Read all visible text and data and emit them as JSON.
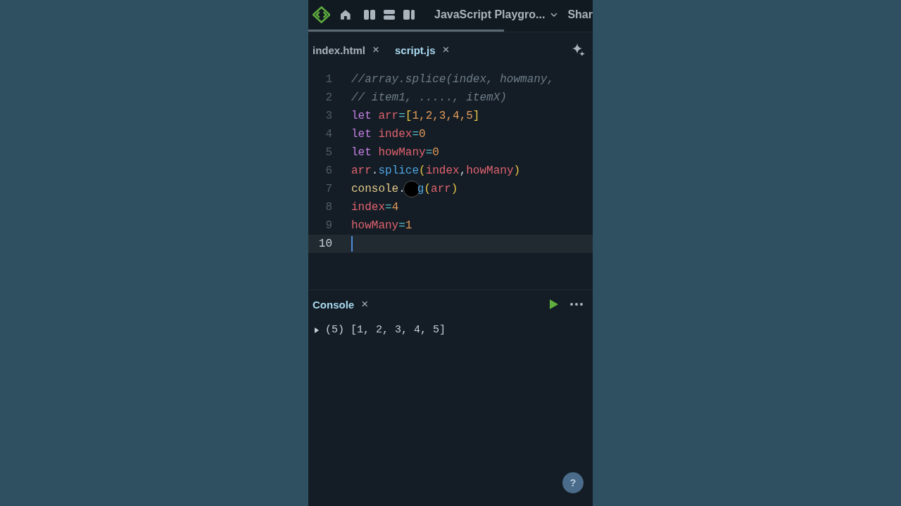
{
  "toolbar": {
    "title": "JavaScript Playgro...",
    "share": "Shar"
  },
  "tabs": [
    {
      "label": "index.html",
      "close": "×",
      "selected": false
    },
    {
      "label": "script.js",
      "close": "×",
      "selected": true
    }
  ],
  "editor": {
    "lines": [
      {
        "number": "1",
        "current": false,
        "tokens": [
          {
            "kind": "comment",
            "text": "//array.splice(index, howmany,"
          }
        ]
      },
      {
        "number": "2",
        "current": false,
        "tokens": [
          {
            "kind": "comment",
            "text": "// item1, ....., itemX)"
          }
        ]
      },
      {
        "number": "3",
        "current": false,
        "tokens": [
          {
            "kind": "keyword",
            "text": "let "
          },
          {
            "kind": "variable",
            "text": "arr"
          },
          {
            "kind": "operator",
            "text": "="
          },
          {
            "kind": "bracket",
            "text": "["
          },
          {
            "kind": "number",
            "text": "1,2,3,4,5"
          },
          {
            "kind": "bracket",
            "text": "]"
          }
        ]
      },
      {
        "number": "4",
        "current": false,
        "tokens": [
          {
            "kind": "keyword",
            "text": "let "
          },
          {
            "kind": "variable",
            "text": "index"
          },
          {
            "kind": "operator",
            "text": "="
          },
          {
            "kind": "number",
            "text": "0"
          }
        ]
      },
      {
        "number": "5",
        "current": false,
        "tokens": [
          {
            "kind": "keyword",
            "text": "let "
          },
          {
            "kind": "variable",
            "text": "howMany"
          },
          {
            "kind": "operator",
            "text": "="
          },
          {
            "kind": "number",
            "text": "0"
          }
        ]
      },
      {
        "number": "6",
        "current": false,
        "tokens": [
          {
            "kind": "variable",
            "text": "arr"
          },
          {
            "kind": "plain",
            "text": "."
          },
          {
            "kind": "function",
            "text": "splice"
          },
          {
            "kind": "bracket",
            "text": "("
          },
          {
            "kind": "variable",
            "text": "index"
          },
          {
            "kind": "plain",
            "text": ","
          },
          {
            "kind": "variable",
            "text": "howMany"
          },
          {
            "kind": "bracket",
            "text": ")"
          }
        ]
      },
      {
        "number": "7",
        "current": false,
        "tokens": [
          {
            "kind": "object",
            "text": "console"
          },
          {
            "kind": "plain",
            "text": "."
          },
          {
            "kind": "pointer"
          },
          {
            "kind": "function",
            "text": "g"
          },
          {
            "kind": "bracket",
            "text": "("
          },
          {
            "kind": "variable",
            "text": "arr"
          },
          {
            "kind": "bracket",
            "text": ")"
          }
        ]
      },
      {
        "number": "8",
        "current": false,
        "tokens": [
          {
            "kind": "variable",
            "text": "index"
          },
          {
            "kind": "operator",
            "text": "="
          },
          {
            "kind": "number",
            "text": "4"
          }
        ]
      },
      {
        "number": "9",
        "current": false,
        "tokens": [
          {
            "kind": "variable",
            "text": "howMany"
          },
          {
            "kind": "operator",
            "text": "="
          },
          {
            "kind": "number",
            "text": "1"
          }
        ]
      },
      {
        "number": "10",
        "current": true
      }
    ]
  },
  "console": {
    "title": "Console",
    "close": "×",
    "output": [
      {
        "expanded": false,
        "text": "(5) [1, 2, 3, 4, 5]"
      }
    ]
  },
  "help": "?"
}
